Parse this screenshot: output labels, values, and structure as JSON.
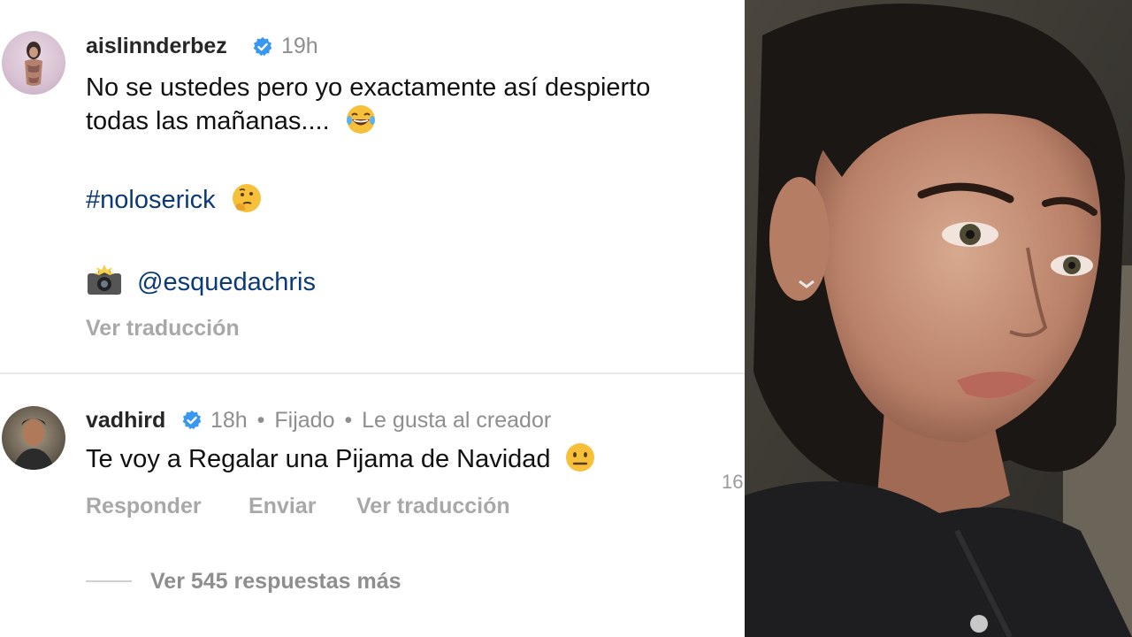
{
  "post": {
    "username": "aislinnderbez",
    "time": "19h",
    "line1": "No se ustedes pero yo exactamente así despierto",
    "line2": "todas las mañanas....",
    "hashtag": "#noloserick",
    "mention": "@esquedachris",
    "translate": "Ver traducción"
  },
  "comment": {
    "username": "vadhird",
    "time": "18h",
    "separator": "•",
    "pinned": "Fijado",
    "liked_by_creator": "Le gusta al creador",
    "text": "Te voy a Regalar una Pijama de Navidad",
    "actions": {
      "reply": "Responder",
      "send": "Enviar",
      "translate": "Ver traducción"
    },
    "view_replies": "Ver 545 respuestas más",
    "cut_number": "16"
  },
  "colors": {
    "verified": "#3897f0",
    "link": "#0b3a78",
    "muted": "#8e8e8e",
    "action": "#a8a8a8"
  },
  "icons": [
    "verified-badge-icon",
    "laughing-emoji-icon",
    "thinking-emoji-icon",
    "camera-flash-emoji-icon",
    "neutral-face-emoji-icon"
  ]
}
